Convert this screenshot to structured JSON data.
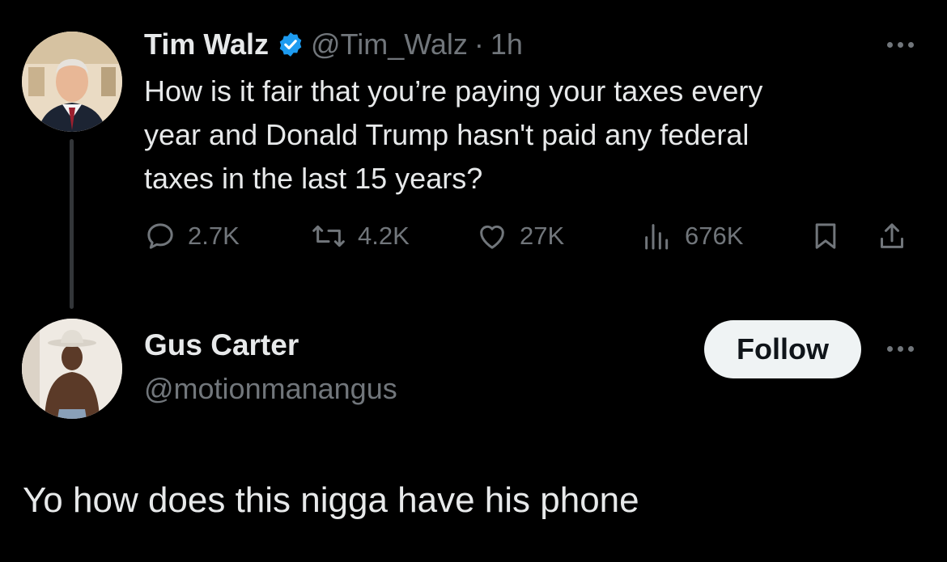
{
  "parent_tweet": {
    "author_name": "Tim Walz",
    "verified": true,
    "handle": "@Tim_Walz",
    "separator": "·",
    "time": "1h",
    "text": "How is it fair that you’re paying your taxes every\nyear and Donald Trump hasn't paid any federal\ntaxes in the last 15 years?",
    "actions": {
      "replies": "2.7K",
      "reposts": "4.2K",
      "likes": "27K",
      "views": "676K"
    },
    "icons": [
      "reply-icon",
      "repost-icon",
      "like-icon",
      "views-icon",
      "bookmark-icon",
      "share-icon",
      "more-icon",
      "verified-badge-icon"
    ]
  },
  "reply_tweet": {
    "author_name": "Gus Carter",
    "handle": "@motionmanangus",
    "follow_label": "Follow",
    "text": "Yo how does this nigga have his phone"
  },
  "colors": {
    "background": "#000000",
    "primary_text": "#e7e9ea",
    "secondary_text": "#71767b",
    "verified_blue": "#1d9bf0",
    "follow_button_bg": "#eff3f4",
    "thread_line": "#333639"
  }
}
